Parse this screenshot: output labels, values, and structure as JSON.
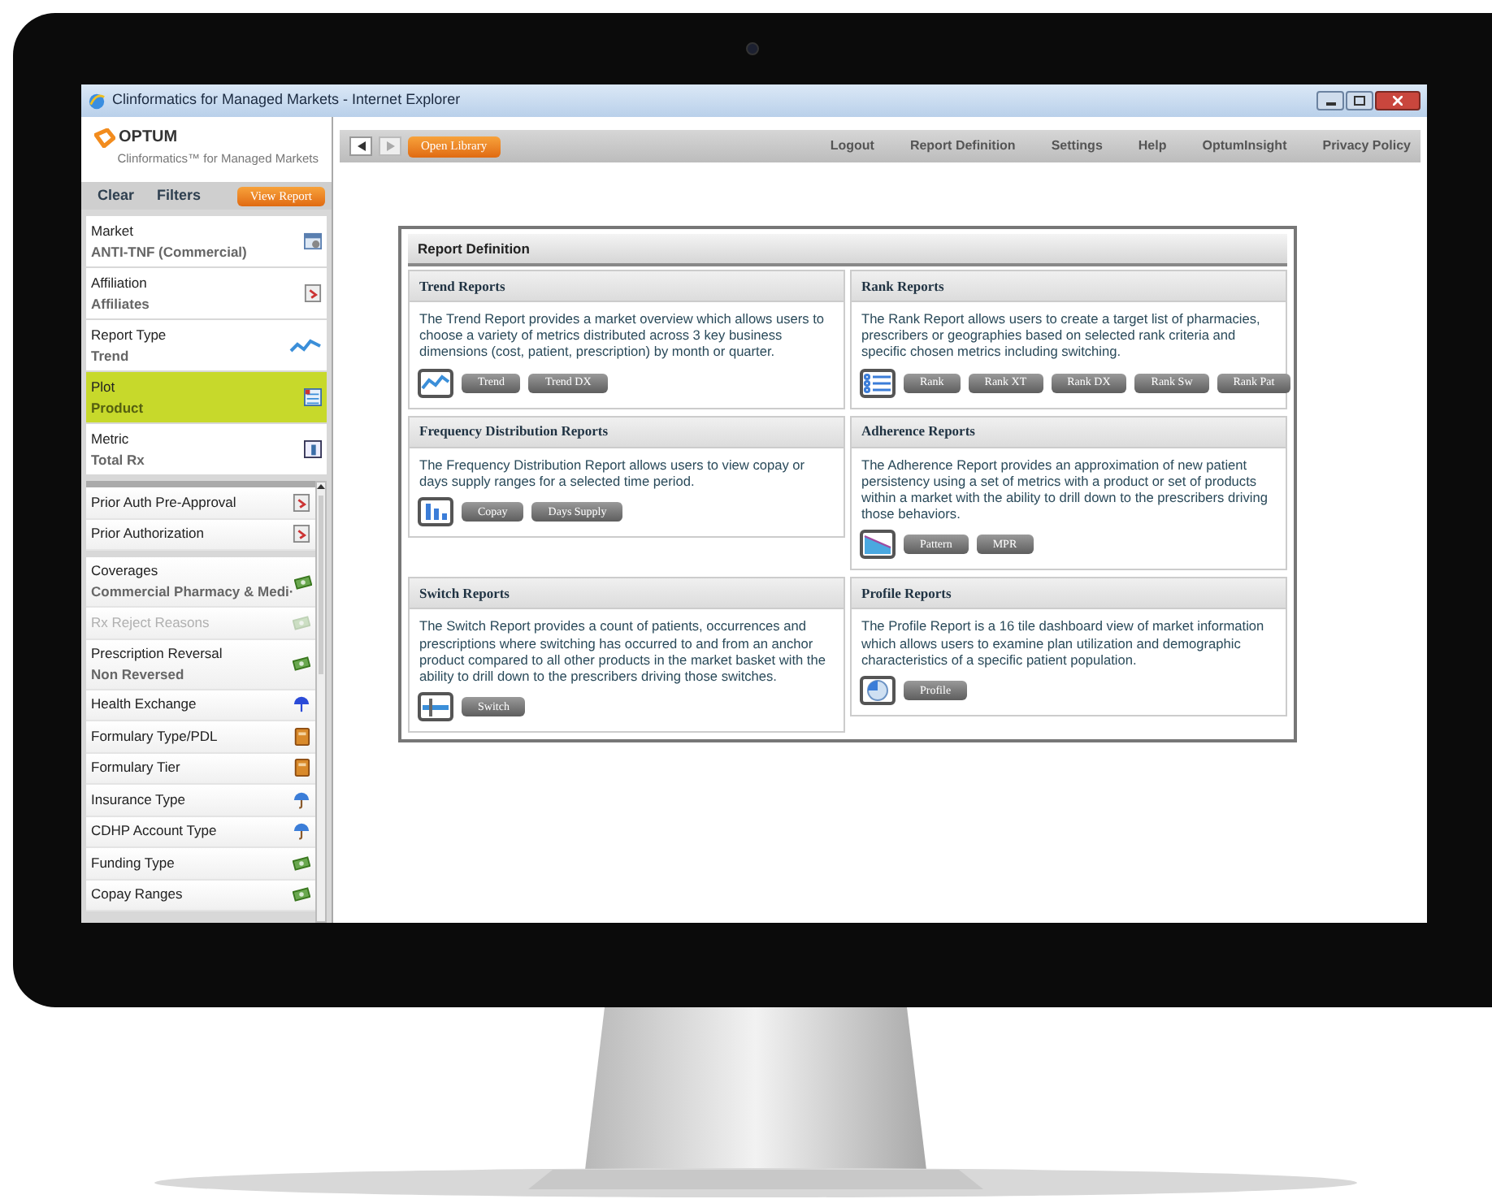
{
  "window": {
    "title": "Clinformatics for Managed Markets - Internet Explorer"
  },
  "logo": {
    "brand": "OPTUM",
    "tagline": "Clinformatics™ for Managed Markets"
  },
  "sidebar_actions": [
    {
      "label": "Clear",
      "kind": "link"
    },
    {
      "label": "Filters",
      "kind": "link"
    },
    {
      "label": "View Report",
      "kind": "primary"
    }
  ],
  "filters": [
    {
      "label": "Market",
      "value": "ANTI-TNF (Commercial)",
      "selected": false
    },
    {
      "label": "Affiliation",
      "value": "Affiliates",
      "selected": false
    },
    {
      "label": "Report Type",
      "value": "Trend",
      "selected": false
    },
    {
      "label": "Plot",
      "value": "Product",
      "selected": true
    },
    {
      "label": "Metric",
      "value": "Total Rx",
      "selected": false
    }
  ],
  "more_filters": [
    [
      {
        "label": "Prior Auth Pre-Approval",
        "disabled": false
      },
      {
        "label": "Prior Authorization",
        "disabled": false
      }
    ],
    [
      {
        "label": "Coverages",
        "value": "Commercial Pharmacy & Medi·",
        "disabled": false
      },
      {
        "label": "Rx Reject Reasons",
        "disabled": true
      },
      {
        "label": "Prescription Reversal",
        "value": "Non Reversed",
        "disabled": false
      },
      {
        "label": "Health Exchange",
        "disabled": false
      },
      {
        "label": "Formulary Type/PDL",
        "disabled": false
      },
      {
        "label": "Formulary Tier",
        "disabled": false
      },
      {
        "label": "Insurance Type",
        "disabled": false
      },
      {
        "label": "CDHP Account Type",
        "disabled": false
      },
      {
        "label": "Funding Type",
        "disabled": false
      },
      {
        "label": "Copay Ranges",
        "disabled": false
      }
    ]
  ],
  "toolbar": {
    "open_library": "Open Library",
    "links": [
      "Logout",
      "Report Definition",
      "Settings",
      "Help",
      "OptumInsight",
      "Privacy Policy"
    ]
  },
  "report_definition": {
    "title": "Report Definition",
    "sections": [
      {
        "title": "Trend Reports",
        "description": "The Trend Report provides a market overview which allows users to choose a variety of metrics distributed across 3 key business dimensions (cost, patient, prescription) by month or quarter.",
        "buttons": [
          "Trend",
          "Trend DX"
        ]
      },
      {
        "title": "Rank Reports",
        "description": "The Rank Report allows users to create a target list of pharmacies, prescribers or geographies based on selected rank criteria and specific chosen metrics including switching.",
        "buttons": [
          "Rank",
          "Rank XT",
          "Rank DX",
          "Rank Sw",
          "Rank Pat"
        ]
      },
      {
        "title": "Frequency Distribution Reports",
        "description": "The Frequency Distribution Report allows users to view copay or days supply ranges for a selected time period.",
        "buttons": [
          "Copay",
          "Days Supply"
        ]
      },
      {
        "title": "Adherence Reports",
        "description": "The Adherence Report provides an approximation of new patient persistency using a set of metrics with a product or set of products within a market with the ability to drill down to the prescribers driving those behaviors.",
        "buttons": [
          "Pattern",
          "MPR"
        ]
      },
      {
        "title": "Switch Reports",
        "description": "The Switch Report provides a count of patients, occurrences and prescriptions where switching has occurred to and from an anchor product compared to all other products in the market basket with the ability to drill down to the prescribers driving those switches.",
        "buttons": [
          "Switch"
        ]
      },
      {
        "title": "Profile Reports",
        "description": "The Profile Report is a 16 tile dashboard view of market information which allows users to examine plan utilization and demographic characteristics of a specific patient population.",
        "buttons": [
          "Profile"
        ]
      }
    ]
  }
}
